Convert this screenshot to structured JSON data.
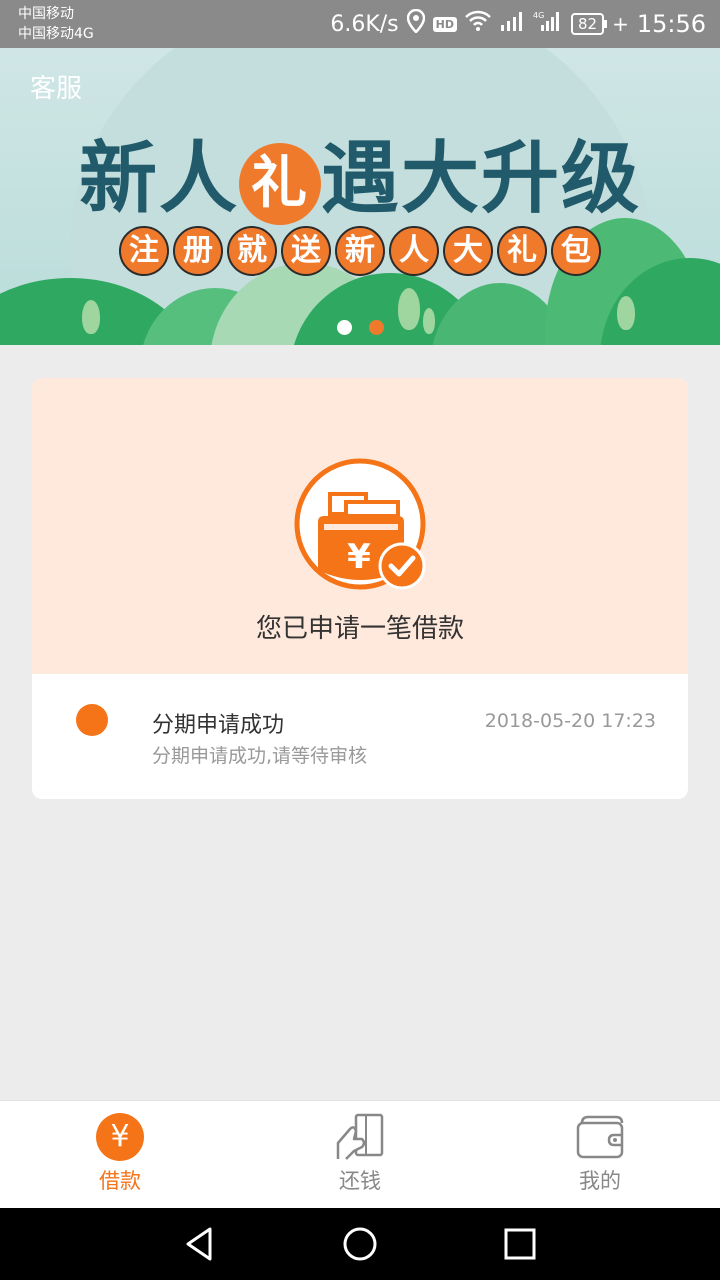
{
  "status_bar": {
    "carrier1": "中国移动",
    "carrier2": "中国移动4G",
    "net_speed": "6.6K/s",
    "hd_label": "HD",
    "battery": "82",
    "time": "15:56",
    "icons": [
      "location-icon",
      "hd-icon",
      "wifi-icon",
      "signal-icon",
      "signal-4g-icon",
      "battery-icon"
    ]
  },
  "banner": {
    "service_label": "客服",
    "title_before": "新人",
    "title_highlight": "礼",
    "title_after": "遇大升级",
    "chips": [
      "注",
      "册",
      "就",
      "送",
      "新",
      "人",
      "大",
      "礼",
      "包"
    ],
    "carousel": {
      "count": 2,
      "active": 1
    },
    "colors": {
      "accent": "#f07a2c",
      "title": "#215a6a",
      "sky": "#cfe6e5",
      "hill": "#2fa862"
    }
  },
  "loan_card": {
    "icon": "wallet-yen-check-icon",
    "status_title": "您已申请一笔借款",
    "timeline": [
      {
        "title": "分期申请成功",
        "subtitle": "分期申请成功,请等待审核",
        "time": "2018-05-20 17:23"
      }
    ]
  },
  "bottom_nav": {
    "items": [
      {
        "label": "借款",
        "icon": "yen-circle-icon",
        "active": true
      },
      {
        "label": "还钱",
        "icon": "hand-card-icon",
        "active": false
      },
      {
        "label": "我的",
        "icon": "wallet-icon",
        "active": false
      }
    ],
    "colors": {
      "active": "#f57418",
      "inactive": "#888888"
    }
  },
  "system_nav": {
    "icons": [
      "back-icon",
      "home-icon",
      "recents-icon"
    ]
  }
}
